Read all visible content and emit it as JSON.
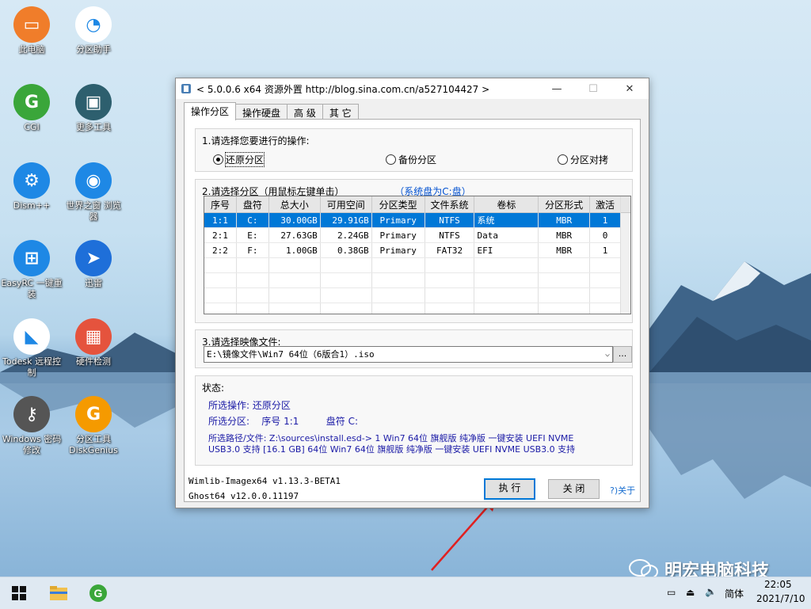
{
  "desktop": {
    "icons": [
      {
        "label": "此电脑",
        "icon": "computer-icon",
        "color": "#f07d2a"
      },
      {
        "label": "分区助手",
        "icon": "partition-assistant-icon",
        "color": "#ffffff"
      },
      {
        "label": "CGI",
        "icon": "cgi-icon",
        "color": "#3aa63a"
      },
      {
        "label": "更多工具",
        "icon": "toolbox-icon",
        "color": "#2d5f6e"
      },
      {
        "label": "Dism++",
        "icon": "dism-icon",
        "color": "#1e88e5"
      },
      {
        "label": "世界之窗 浏览器",
        "icon": "browser-icon",
        "color": "#1e88e5"
      },
      {
        "label": "EasyRC 一键重装",
        "icon": "windows-icon",
        "color": "#1e88e5"
      },
      {
        "label": "迅雷",
        "icon": "thunder-icon",
        "color": "#1e6fd9"
      },
      {
        "label": "Todesk 远程控制",
        "icon": "todesk-icon",
        "color": "#ffffff"
      },
      {
        "label": "硬件检测",
        "icon": "chip-icon",
        "color": "#e5533d"
      },
      {
        "label": "Windows 密码修改",
        "icon": "key-icon",
        "color": "#555555"
      },
      {
        "label": "分区工具 DiskGenius",
        "icon": "diskgenius-icon",
        "color": "#f59a00"
      }
    ],
    "icon_glyphs": [
      "▭",
      "◔",
      "G",
      "▣",
      "⚙",
      "◉",
      "⊞",
      "➤",
      "◣",
      "▦",
      "⚷",
      "G"
    ]
  },
  "window": {
    "title": "< 5.0.0.6 x64 资源外置 http://blog.sina.com.cn/a527104427 >",
    "minimize": "—",
    "maximize": "☐",
    "close": "✕",
    "tabs": [
      "操作分区",
      "操作硬盘",
      "高 级",
      "其 它"
    ],
    "section1": {
      "title": "1.请选择您要进行的操作:",
      "options": [
        "还原分区",
        "备份分区",
        "分区对拷"
      ],
      "selected": 0
    },
    "section2": {
      "title": "2.请选择分区（用鼠标左键单击）",
      "hint": "（系统盘为C:盘）",
      "columns": [
        "序号",
        "盘符",
        "总大小",
        "可用空间",
        "分区类型",
        "文件系统",
        "卷标",
        "分区形式",
        "激活"
      ],
      "rows": [
        [
          "1:1",
          "C:",
          "30.00GB",
          "29.91GB",
          "Primary",
          "NTFS",
          "系统",
          "MBR",
          "1"
        ],
        [
          "2:1",
          "E:",
          "27.63GB",
          "2.24GB",
          "Primary",
          "NTFS",
          "Data",
          "MBR",
          "0"
        ],
        [
          "2:2",
          "F:",
          "1.00GB",
          "0.38GB",
          "Primary",
          "FAT32",
          "EFI",
          "MBR",
          "1"
        ]
      ],
      "selected_row": 0
    },
    "section3": {
      "title": "3.请选择映像文件:",
      "value": "E:\\镜像文件\\Win7 64位（6版合1）.iso",
      "browse": "..."
    },
    "status": {
      "title": "状态:",
      "operation": "所选操作: 还原分区",
      "partition": "所选分区:    序号 1:1         盘符 C:",
      "path_line1": "所选路径/文件: Z:\\sources\\install.esd-> 1 Win7 64位 旗舰版 纯净版 一键安装 UEFI NVME",
      "path_line2": "USB3.0 支持 [16.1 GB] 64位 Win7 64位 旗舰版 纯净版 一键安装 UEFI NVME USB3.0 支持"
    },
    "footer": {
      "wimlib": "Wimlib-Imagex64 v1.13.3-BETA1",
      "ghost": "Ghost64 v12.0.0.11197",
      "execute": "执 行",
      "close": "关 闭",
      "about": "?)关于"
    }
  },
  "taskbar": {
    "lang": "简体",
    "time": "22:05",
    "date": "2021/7/10"
  },
  "watermark": "明宏电脑科技",
  "colors": {
    "accent": "#0078d7",
    "status_text": "#1a1aa6",
    "section_hint": "#0050d0",
    "arrow": "#e02020"
  }
}
